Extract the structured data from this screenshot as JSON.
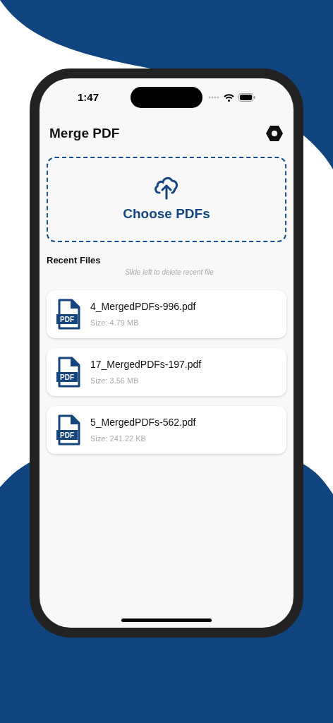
{
  "status_bar": {
    "time": "1:47"
  },
  "header": {
    "title": "Merge PDF"
  },
  "upload": {
    "label": "Choose PDFs"
  },
  "recent": {
    "title": "Recent Files",
    "hint": "Slide left to delete recent file",
    "files": [
      {
        "name": "4_MergedPDFs-996.pdf",
        "size": "Size: 4.79 MB",
        "icon_label": "PDF"
      },
      {
        "name": "17_MergedPDFs-197.pdf",
        "size": "Size: 3.56 MB",
        "icon_label": "PDF"
      },
      {
        "name": "5_MergedPDFs-562.pdf",
        "size": "Size: 241.22 KB",
        "icon_label": "PDF"
      }
    ]
  }
}
